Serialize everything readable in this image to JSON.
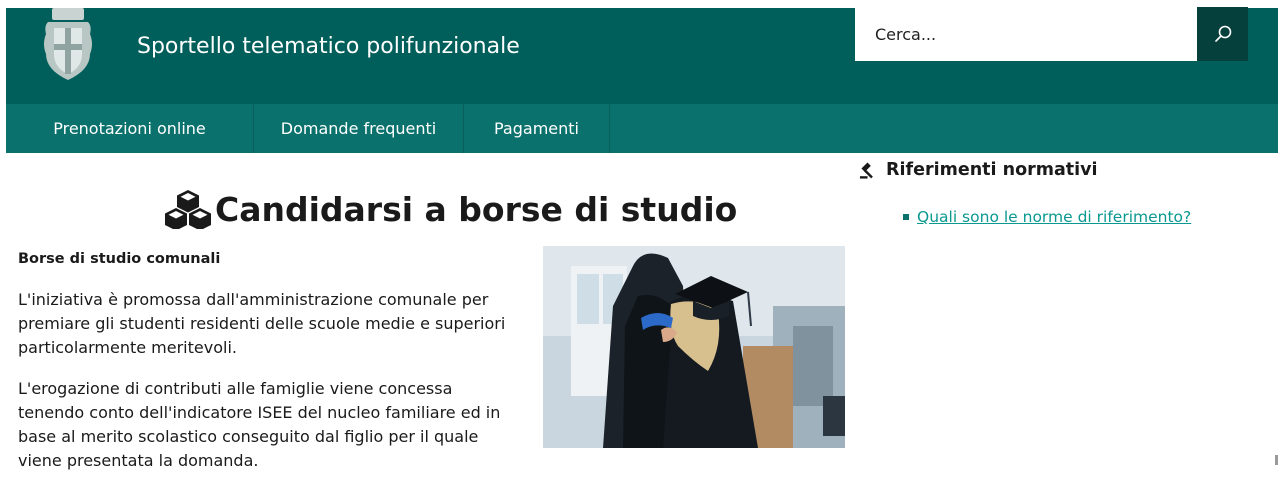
{
  "header": {
    "site_title": "Sportello telematico polifunzionale",
    "logo_icon": "municipal-crest-icon",
    "search": {
      "placeholder": "Cerca...",
      "value": "",
      "button_icon": "search-icon"
    }
  },
  "nav": {
    "items": [
      {
        "label": "Prenotazioni online"
      },
      {
        "label": "Domande frequenti"
      },
      {
        "label": "Pagamenti"
      }
    ]
  },
  "main": {
    "title_icon": "cubes-icon",
    "title": "Candidarsi a borse di studio",
    "section_heading": "Borse di studio comunali",
    "paragraphs": [
      "L'iniziativa è promossa dall'amministrazione comunale per premiare gli studenti residenti delle scuole medie e superiori particolarmente meritevoli.",
      "L'erogazione di contributi alle famiglie viene concessa tenendo conto dell'indicatore ISEE del nucleo familiare ed in base al merito scolastico conseguito dal figlio per il quale viene presentata la domanda."
    ],
    "photo": "graduates-hugging-photo"
  },
  "sidebar": {
    "heading_icon": "gavel-icon",
    "heading": "Riferimenti normativi",
    "links": [
      {
        "label": "Quali sono le norme di riferimento?"
      }
    ]
  },
  "colors": {
    "header_bg": "#005e5b",
    "nav_bg": "#0a716c",
    "search_button_bg": "#06403d",
    "link": "#0a9891"
  }
}
